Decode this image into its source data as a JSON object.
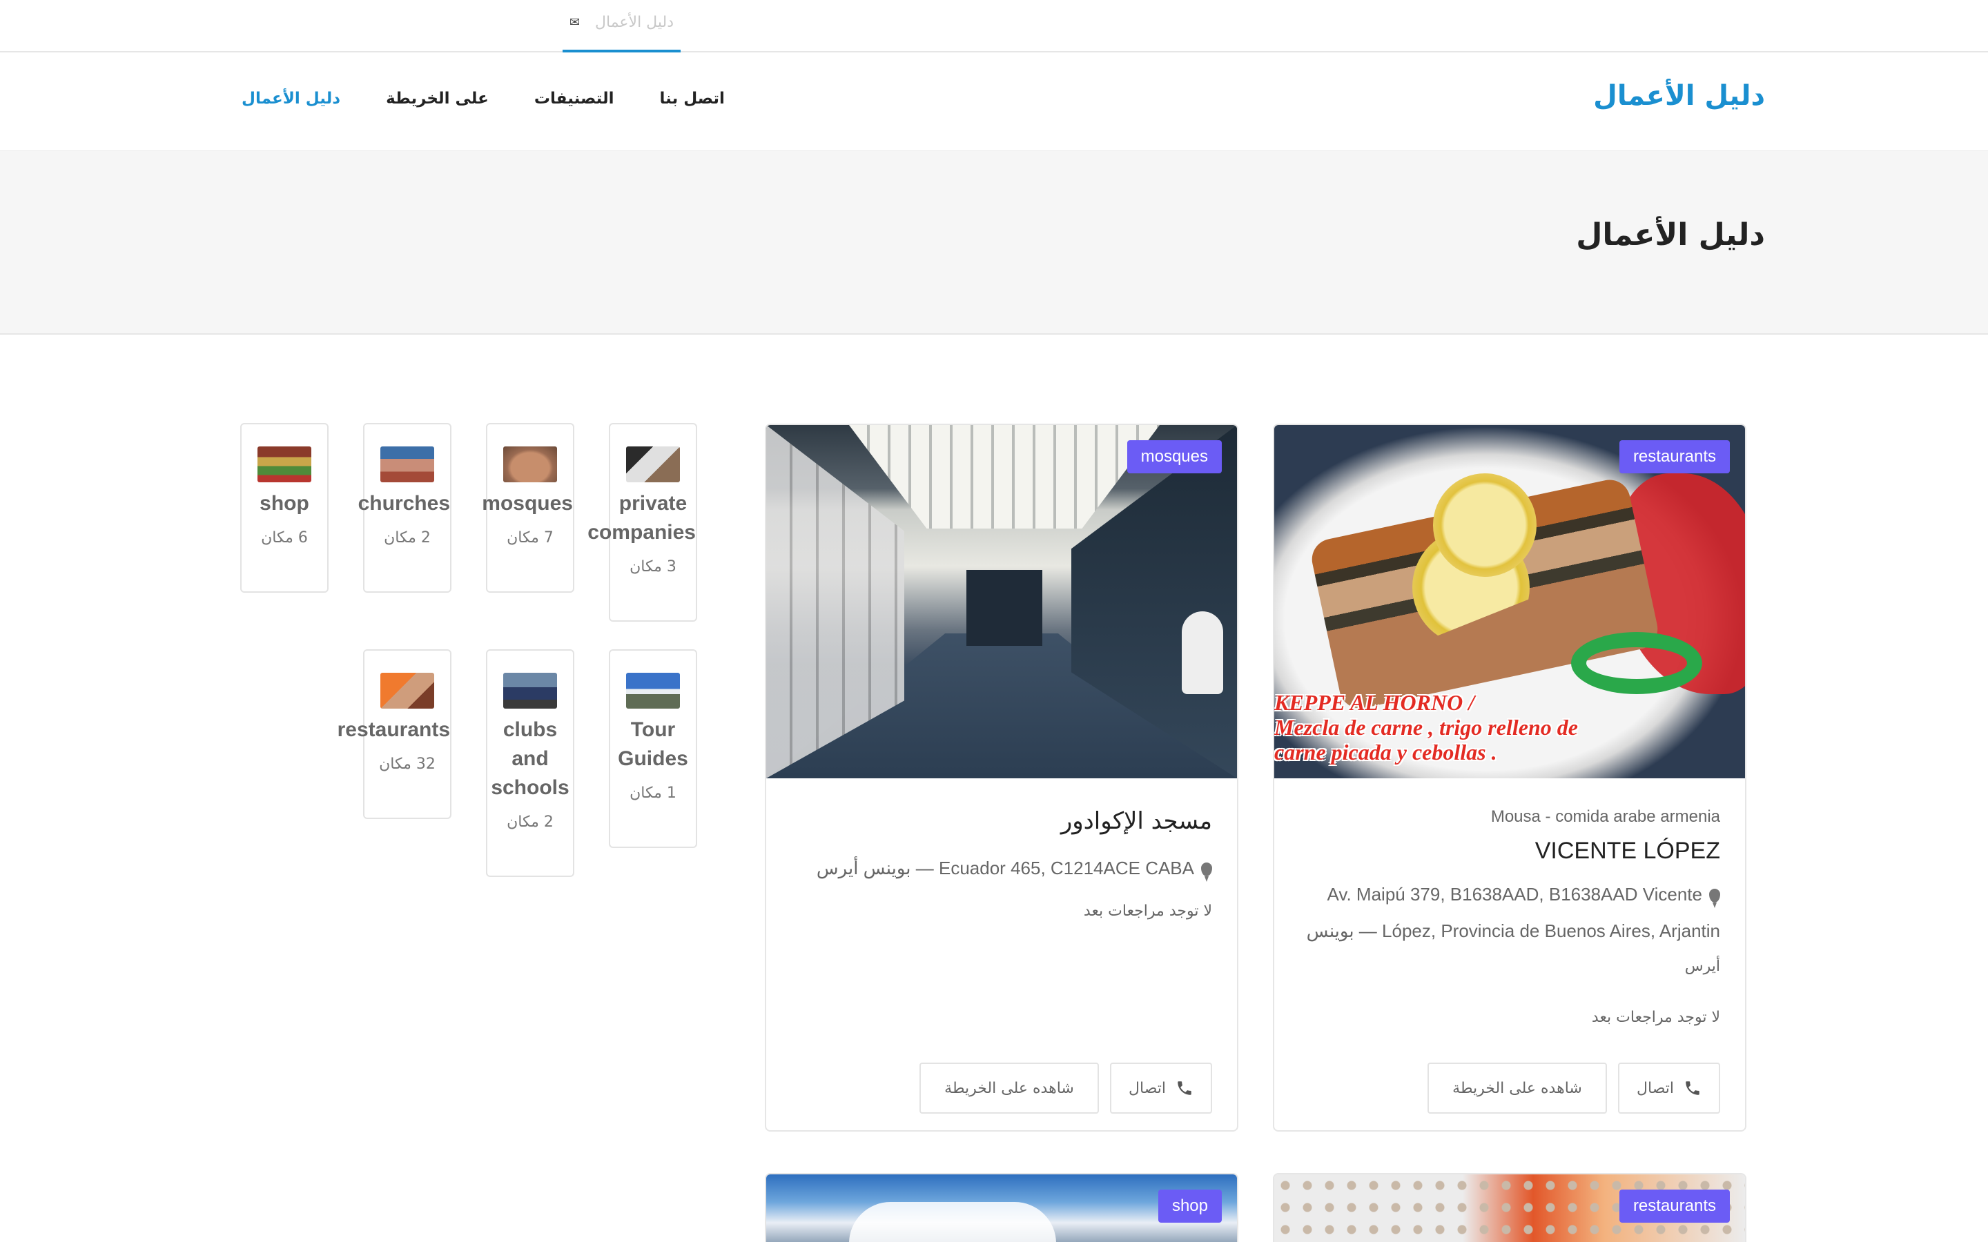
{
  "topstrip": {
    "ghost_tab_label": "دليل الأعمال"
  },
  "header": {
    "brand": "دليل الأعمال",
    "nav": [
      {
        "label": "دليل الأعمال",
        "active": true
      },
      {
        "label": "على الخريطة",
        "active": false
      },
      {
        "label": "التصنيفات",
        "active": false
      },
      {
        "label": "اتصل بنا",
        "active": false
      }
    ]
  },
  "hero": {
    "title": "دليل الأعمال"
  },
  "categories": [
    {
      "name": "shop",
      "count": "6 مكان",
      "icon": "shop-image"
    },
    {
      "name": "churches",
      "count": "2 مكان",
      "icon": "church-image"
    },
    {
      "name": "mosques",
      "count": "7 مكان",
      "icon": "mosque-image"
    },
    {
      "name": "private companies",
      "count": "3 مكان",
      "icon": "office-image"
    },
    {
      "name": "restaurants",
      "count": "32 مكان",
      "icon": "food-image"
    },
    {
      "name": "clubs and schools",
      "count": "2 مكان",
      "icon": "school-image"
    },
    {
      "name": "Tour Guides",
      "count": "1 مكان",
      "icon": "mountain-image"
    }
  ],
  "listings": [
    {
      "badge": "restaurants",
      "subtitle": "Mousa - comida arabe armenia",
      "title": "VICENTE LÓPEZ",
      "address_lines": [
        "Av. Maipú 379, B1638AAD, B1638AAD Vicente",
        "López, Provincia de Buenos Aires, Arjantin — بوينس",
        "أيرس"
      ],
      "reviews": "لا توجد مراجعات بعد",
      "call_label": "اتصال",
      "map_label": "شاهده على الخريطة",
      "image_caption": [
        "KEPPE AL HORNO /",
        "Mezcla de carne , trigo relleno de",
        "carne picada y cebollas ."
      ]
    },
    {
      "badge": "mosques",
      "title": "مسجد الإكوادور",
      "address_lines": [
        "Ecuador 465, C1214ACE CABA — بوينس أيرس"
      ],
      "reviews": "لا توجد مراجعات بعد",
      "call_label": "اتصال",
      "map_label": "شاهده على الخريطة"
    },
    {
      "badge": "restaurants"
    },
    {
      "badge": "shop"
    }
  ],
  "colors": {
    "accent": "#1a8fd0",
    "badge": "#6b5cf5",
    "hero_bg": "#f6f6f6"
  }
}
